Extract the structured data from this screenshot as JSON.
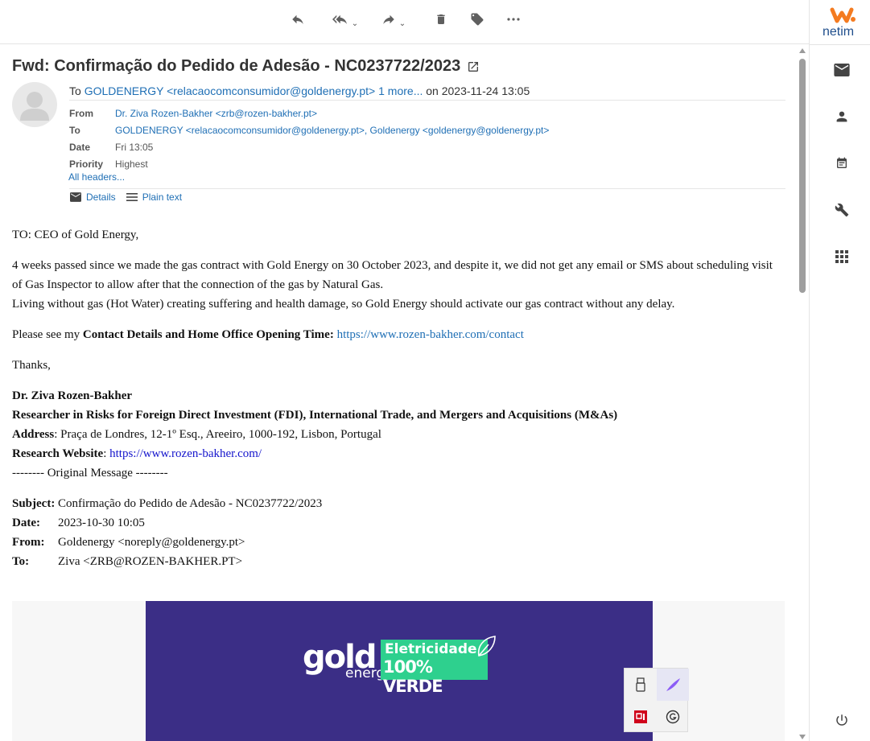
{
  "toolbar": {
    "reply": "reply-icon",
    "reply_all": "reply-all-icon",
    "forward": "forward-icon",
    "delete": "trash-icon",
    "tag": "tag-icon",
    "more": "more-icon"
  },
  "brand": {
    "name": "netim",
    "color": "#f47b20"
  },
  "message": {
    "subject": "Fwd: Confirmação do Pedido de Adesão - NC0237722/2023",
    "summary_to_label": "To",
    "summary_to": "GOLDENERGY <relacaocomconsumidor@goldenergy.pt>",
    "summary_more": "1 more...",
    "summary_on": "on 2023-11-24 13:05",
    "headers": [
      {
        "label": "From",
        "value": "Dr. Ziva Rozen-Bakher <zrb@rozen-bakher.pt>",
        "link": true
      },
      {
        "label": "To",
        "value": "GOLDENERGY <relacaocomconsumidor@goldenergy.pt>, Goldenergy <goldenergy@goldenergy.pt>",
        "link": true
      },
      {
        "label": "Date",
        "value": "Fri 13:05",
        "link": false
      },
      {
        "label": "Priority",
        "value": "Highest",
        "link": false
      }
    ],
    "all_headers": "All headers...",
    "details": "Details",
    "plain_text": "Plain text"
  },
  "body": {
    "greeting": "TO: CEO of Gold Energy,",
    "para1": "4 weeks passed since we made the gas contract with Gold Energy on 30 October 2023, and despite it, we did not get any email or SMS about scheduling visit of Gas Inspector to allow after that the connection of the gas by Natural Gas.",
    "para1b": "Living without gas (Hot Water) creating suffering and health damage, so Gold Energy should activate our gas contract without any delay.",
    "please_prefix": "Please see my ",
    "please_bold": "Contact Details and Home Office Opening Time:",
    "please_link": "https://www.rozen-bakher.com/contact",
    "thanks": "Thanks,",
    "sig_name": "Dr. Ziva Rozen-Bakher",
    "sig_title": "Researcher in Risks for Foreign Direct Investment (FDI), International Trade, and Mergers and Acquisitions (M&As)",
    "sig_address_label": "Address",
    "sig_address": ": Praça de Londres, 12-1º Esq., Areeiro, 1000-192, Lisbon, Portugal",
    "sig_web_label": "Research Website",
    "sig_web_sep": ": ",
    "sig_web": "https://www.rozen-bakher.com/",
    "original": "-------- Original Message --------",
    "orig_rows": [
      {
        "label": "Subject:",
        "value": "Confirmação do Pedido de Adesão - NC0237722/2023"
      },
      {
        "label": "Date:",
        "value": "2023-10-30 10:05"
      },
      {
        "label": "From:",
        "value": "Goldenergy <noreply@goldenergy.pt>"
      },
      {
        "label": "To:",
        "value": "Ziva <ZRB@ROZEN-BAKHER.PT>"
      }
    ]
  },
  "banner": {
    "gold": "gold",
    "energy": "energy",
    "badge_l1": "Eletricidade",
    "badge_l2": "100% VERDE",
    "bg_color": "#3b2e86",
    "badge_color": "#2ed08e"
  }
}
